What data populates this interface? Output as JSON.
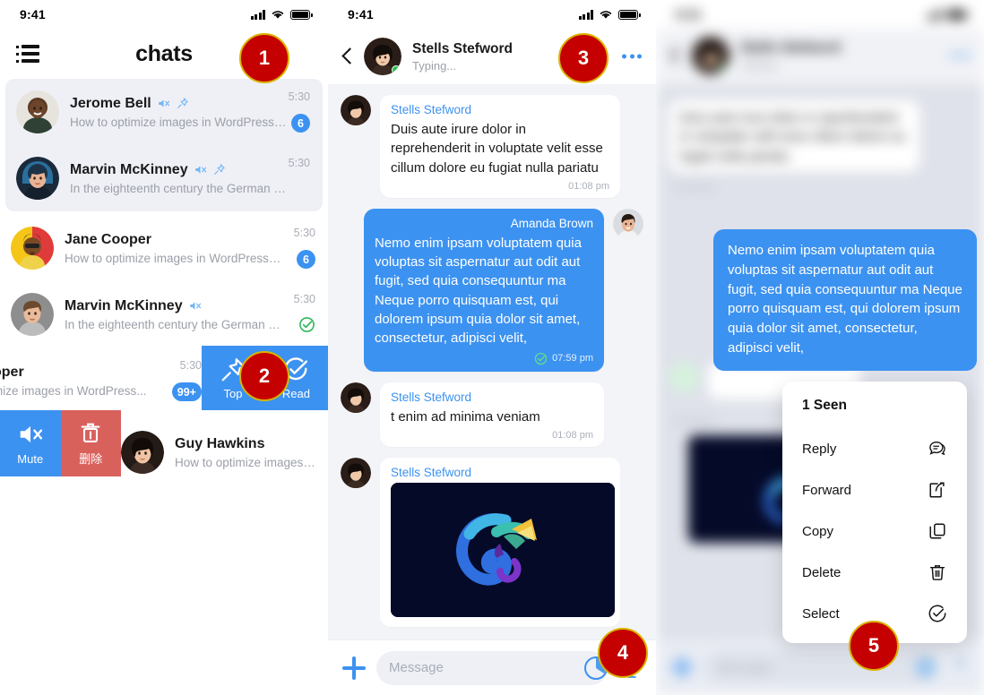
{
  "statusbar": {
    "time": "9:41",
    "signal_icon": "cellular-bars-icon",
    "wifi_icon": "wifi-icon",
    "battery_icon": "battery-full-icon"
  },
  "chat_list": {
    "menu_icon": "list-menu-icon",
    "title": "chats",
    "rows": [
      {
        "name": "Jerome Bell",
        "preview": "How to optimize images in WordPress for...",
        "time": "5:30",
        "badge": "6",
        "muted": true,
        "pinned": true,
        "read_check": false,
        "avatar": "avatar-jerome-bell"
      },
      {
        "name": "Marvin McKinney",
        "preview": "In the eighteenth century the German philosoph...",
        "time": "5:30",
        "badge": "",
        "muted": true,
        "pinned": true,
        "read_check": false,
        "avatar": "avatar-marvin-mckinney-1"
      },
      {
        "name": "Jane Cooper",
        "preview": "How to optimize images in WordPress for...",
        "time": "5:30",
        "badge": "6",
        "muted": false,
        "pinned": false,
        "read_check": false,
        "avatar": "avatar-jane-cooper"
      },
      {
        "name": "Marvin McKinney",
        "preview": "In the eighteenth century the German philos...",
        "time": "5:30",
        "badge": "",
        "muted": true,
        "pinned": false,
        "read_check": true,
        "avatar": "avatar-marvin-mckinney-2"
      },
      {
        "name": "oper",
        "preview": "mize images in WordPress...",
        "time": "5:30",
        "badge": "99+",
        "muted": false,
        "pinned": false,
        "read_check": false,
        "avatar": "avatar-cooper-partial"
      },
      {
        "name": "Guy Hawkins",
        "preview": "How to optimize images in W",
        "time": "",
        "badge": "",
        "muted": false,
        "pinned": false,
        "read_check": false,
        "avatar": "avatar-guy-hawkins"
      }
    ],
    "swipe_right_actions": [
      {
        "label": "Top",
        "icon": "pin-icon"
      },
      {
        "label": "Read",
        "icon": "check-circle-icon"
      }
    ],
    "swipe_left_actions": [
      {
        "label": "Mute",
        "icon": "mute-icon"
      },
      {
        "label": "删除",
        "icon": "trash-icon"
      }
    ]
  },
  "conversation": {
    "back_icon": "back-chevron-icon",
    "contact_name": "Stells Stefword",
    "status": "Typing...",
    "more_icon": "more-options-icon",
    "messages": [
      {
        "side": "in",
        "sender": "Stells Stefword",
        "text": "Duis aute irure dolor in reprehenderit in voluptate velit esse cillum dolore eu fugiat nulla pariatu",
        "time": "01:08 pm",
        "has_check": false,
        "type": "text"
      },
      {
        "side": "out",
        "sender": "Amanda Brown",
        "text": "Nemo enim ipsam voluptatem quia voluptas sit aspernatur aut odit aut fugit, sed quia consequuntur ma Neque porro quisquam est, qui dolorem ipsum quia dolor sit amet, consectetur, adipisci velit,",
        "time": "07:59 pm",
        "has_check": true,
        "type": "text"
      },
      {
        "side": "in",
        "sender": "Stells Stefword",
        "text": "t enim ad minima veniam",
        "time": "01:08 pm",
        "has_check": false,
        "type": "text"
      },
      {
        "side": "in",
        "sender": "Stells Stefword",
        "text": "",
        "time": "",
        "has_check": false,
        "type": "image",
        "image_name": "chameleon-logo-image"
      }
    ],
    "input": {
      "plus_icon": "add-attachment-icon",
      "placeholder": "Message",
      "value": "",
      "emoji_icon": "emoji-icon",
      "mic_icon": "microphone-icon"
    }
  },
  "context_panel": {
    "highlighted_message": "Nemo enim ipsam voluptatem quia voluptas sit aspernatur aut odit aut fugit, sed quia consequuntur ma Neque porro quisquam est, qui dolorem ipsum quia dolor sit amet, consectetur, adipisci velit,",
    "menu": {
      "title": "1 Seen",
      "items": [
        {
          "label": "Reply",
          "icon": "reply-icon"
        },
        {
          "label": "Forward",
          "icon": "forward-icon"
        },
        {
          "label": "Copy",
          "icon": "copy-icon"
        },
        {
          "label": "Delete",
          "icon": "trash-icon"
        },
        {
          "label": "Select",
          "icon": "select-check-icon"
        }
      ]
    }
  },
  "markers": [
    {
      "id": "1",
      "label": "1"
    },
    {
      "id": "2",
      "label": "2"
    },
    {
      "id": "3",
      "label": "3"
    },
    {
      "id": "4",
      "label": "4"
    },
    {
      "id": "5",
      "label": "5"
    }
  ],
  "colors": {
    "accent_blue": "#3c92f0",
    "delete_red": "#d9615c",
    "marker_red": "#c40000",
    "marker_ring": "#d9b300",
    "green_check": "#21c24a",
    "list_bg": "#f3f4f8"
  }
}
